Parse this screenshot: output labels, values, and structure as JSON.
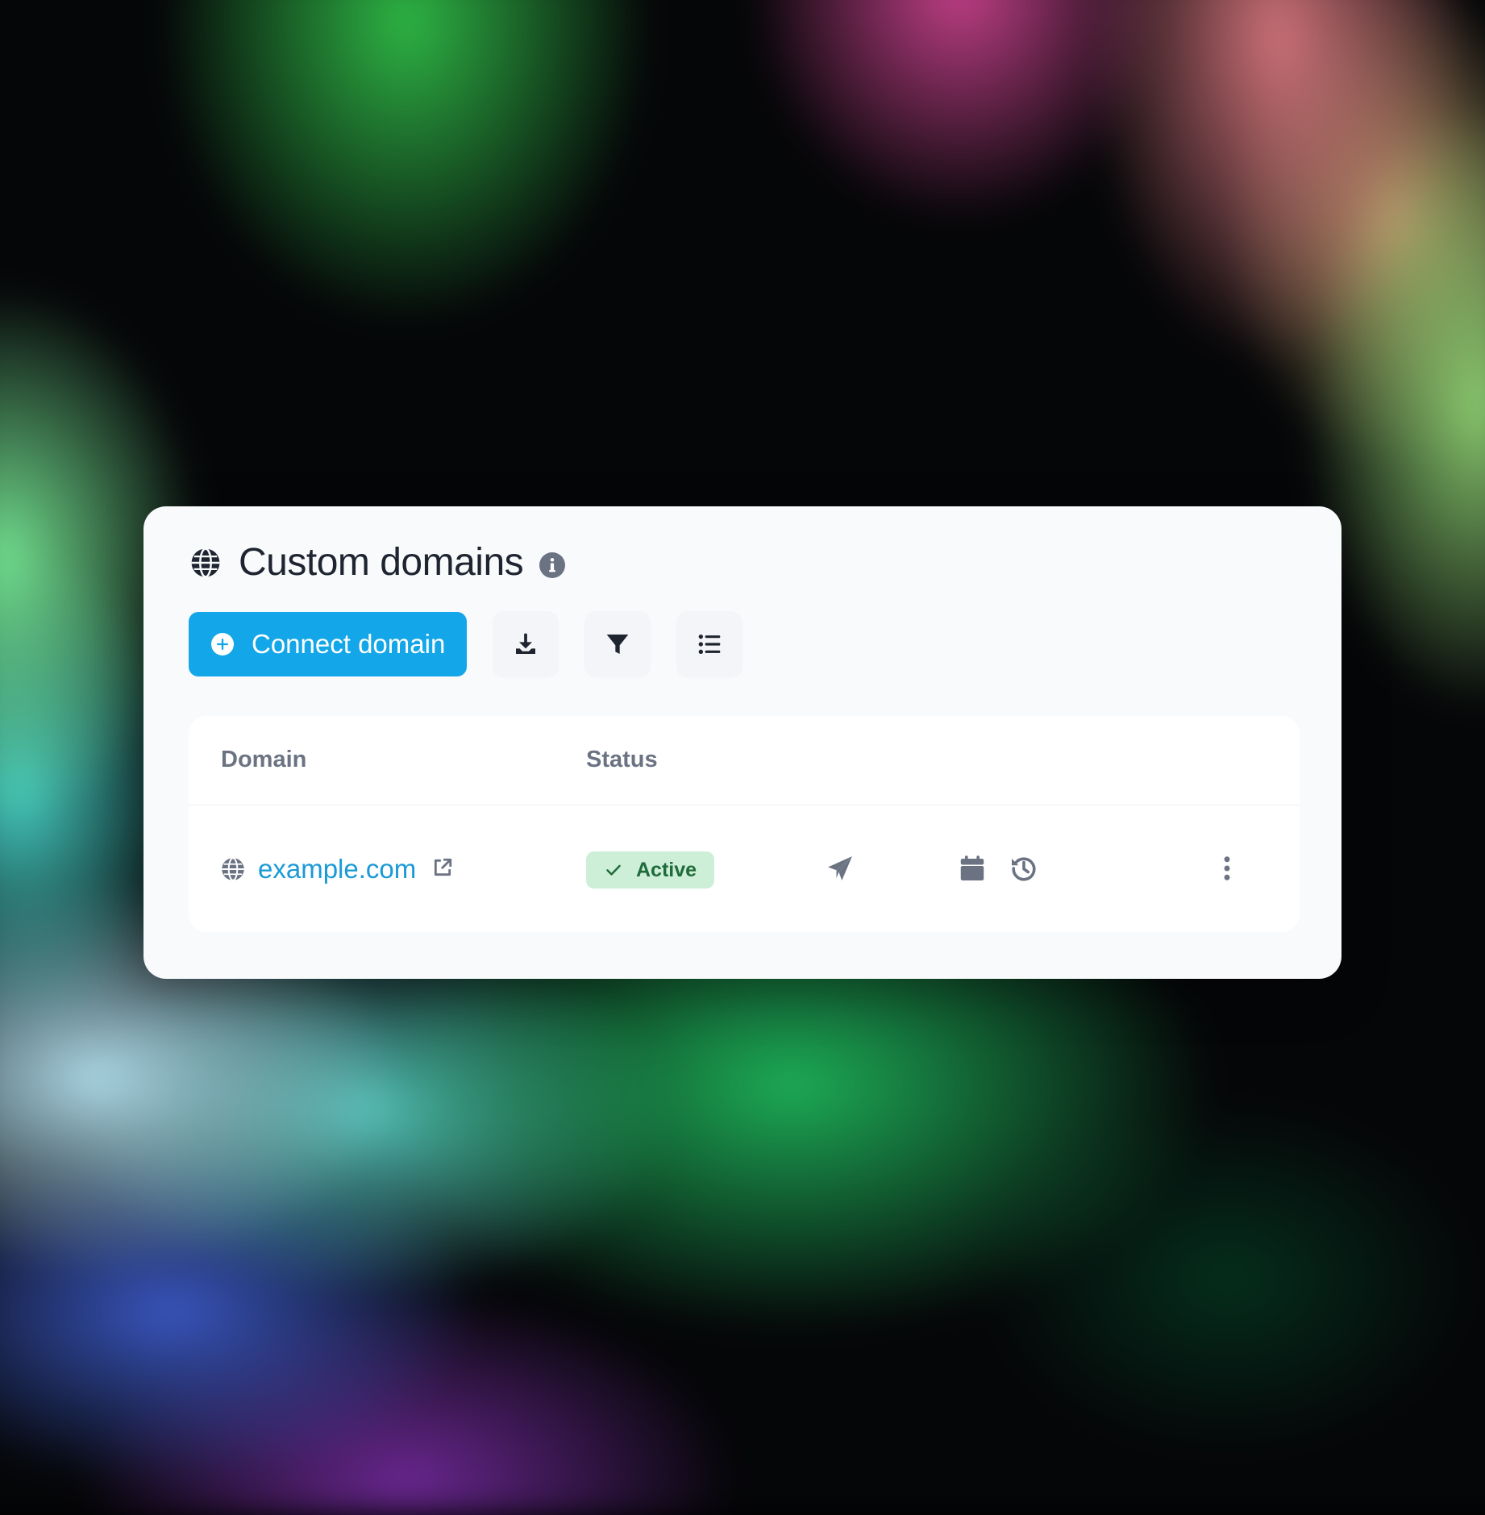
{
  "card": {
    "title": "Custom domains",
    "title_icon": "globe-icon",
    "info_icon": "info-icon"
  },
  "toolbar": {
    "connect_label": "Connect domain",
    "connect_icon": "plus-circle-icon",
    "icon_buttons": [
      "download-icon",
      "filter-icon",
      "list-icon"
    ]
  },
  "table": {
    "columns": [
      "Domain",
      "Status"
    ],
    "rows": [
      {
        "domain": "example.com",
        "status": "Active",
        "action_icons": [
          "send-icon",
          "calendar-icon",
          "history-icon",
          "more-vertical-icon"
        ]
      }
    ]
  },
  "colors": {
    "primary": "#13a6e8",
    "link": "#1a9ad6",
    "status_active_bg": "#cdeed7",
    "status_active_text": "#1f6b3a",
    "card_bg": "#f8fafc"
  }
}
